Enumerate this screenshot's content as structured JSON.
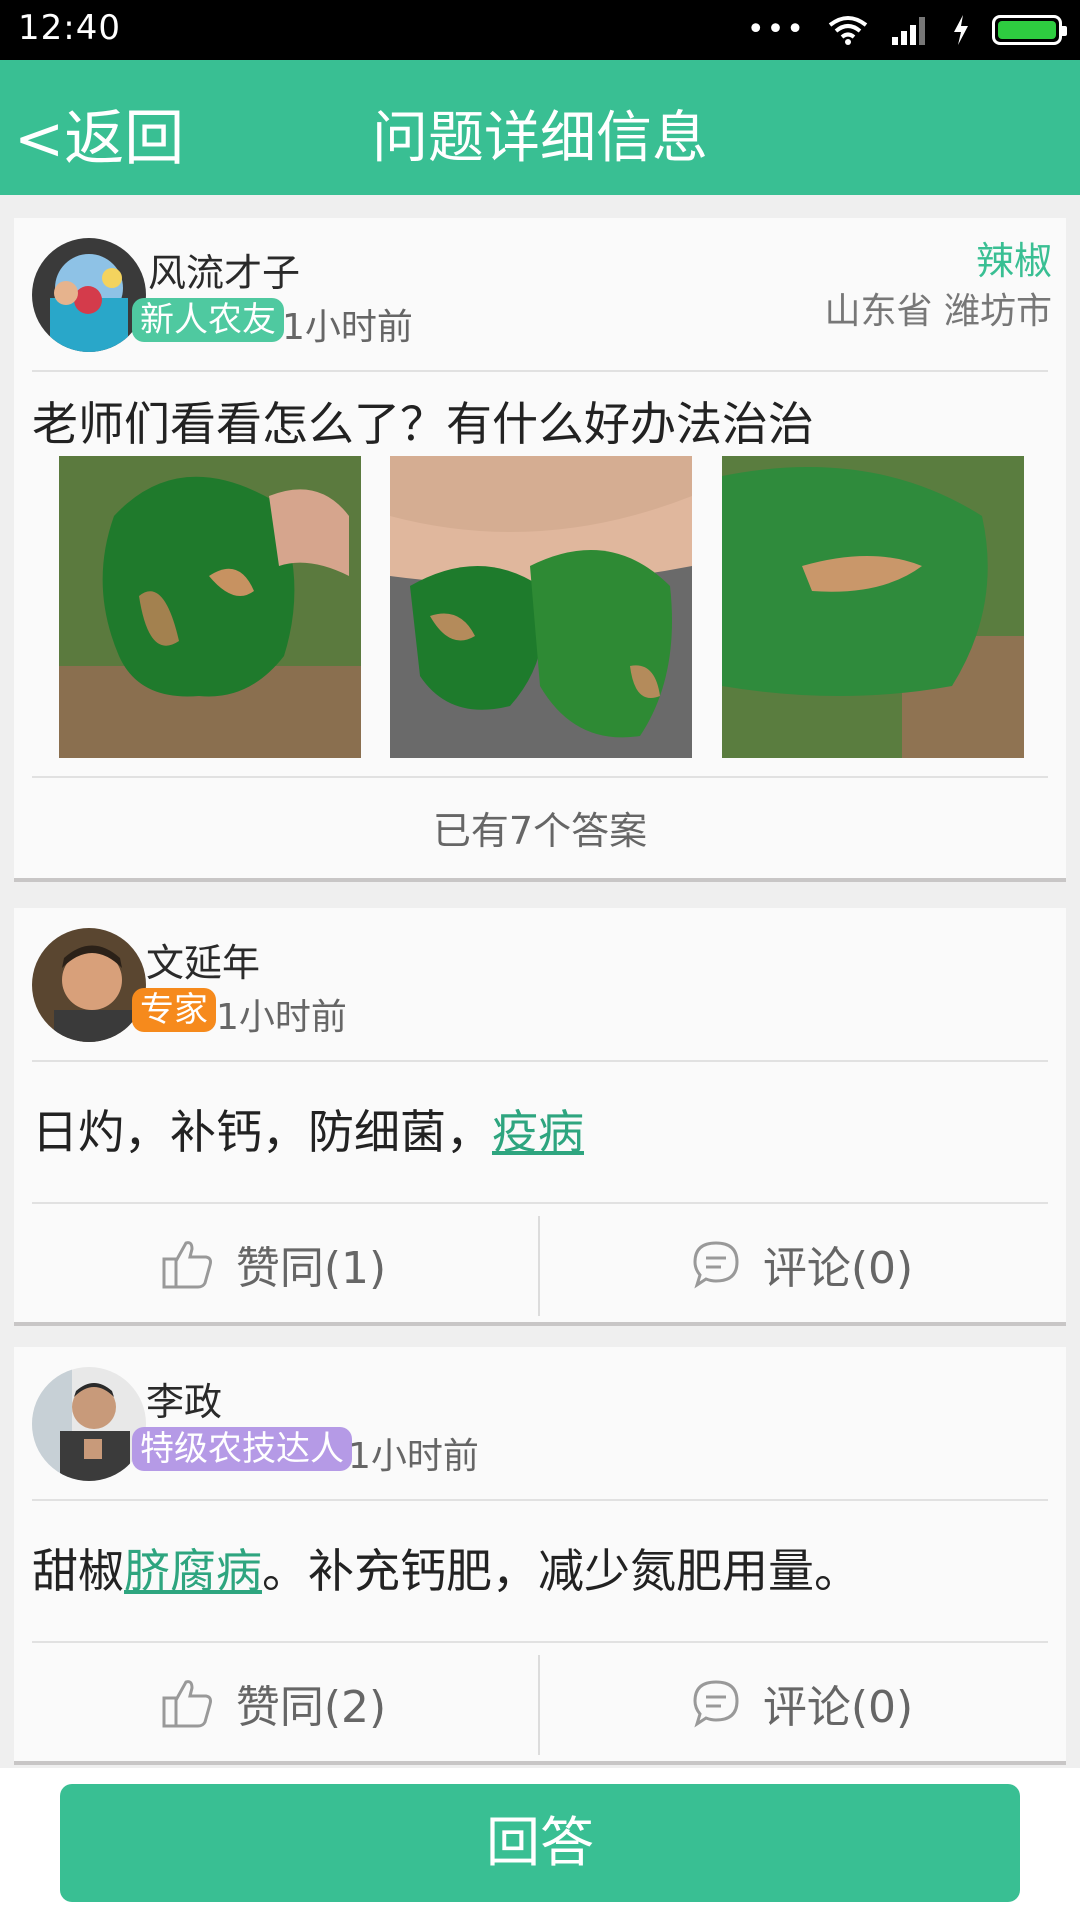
{
  "status_bar": {
    "time": "12:40",
    "more": "•••"
  },
  "header": {
    "back_label": "<返回",
    "title": "问题详细信息"
  },
  "question": {
    "username": "风流才子",
    "badge": "新人农友",
    "time_ago": "1小时前",
    "crop": "辣椒",
    "location": "山东省 潍坊市",
    "text": "老师们看看怎么了？有什么好办法治治",
    "answers_count": "已有7个答案"
  },
  "answers": [
    {
      "username": "文延年",
      "badge": "专家",
      "time_ago": "1小时前",
      "text_before": "日灼，补钙，防细菌，",
      "link": "疫病",
      "text_after": "",
      "like_label": "赞同(1)",
      "comment_label": "评论(0)"
    },
    {
      "username": "李政",
      "badge": "特级农技达人",
      "time_ago": "1小时前",
      "text_before": "甜椒",
      "link": "脐腐病",
      "text_after": "。补充钙肥，减少氮肥用量。",
      "like_label": "赞同(2)",
      "comment_label": "评论(0)"
    }
  ],
  "footer": {
    "answer_button": "回答"
  },
  "colors": {
    "primary": "#39bf93",
    "link": "#2ea57f",
    "expert_badge": "#f68a1c",
    "newbie_badge": "#4fc9a0",
    "master_badge": "#b59ae6"
  }
}
